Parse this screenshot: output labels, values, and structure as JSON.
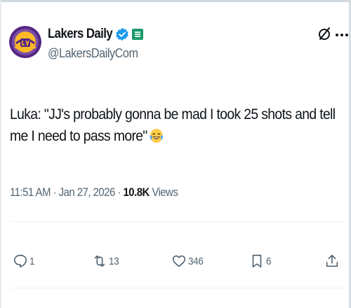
{
  "author": {
    "display_name": "Lakers Daily",
    "handle": "@LakersDailyCom",
    "verified": true,
    "affiliate_badge": true
  },
  "tweet": {
    "text": "Luka: \"JJ's probably gonna be mad I took 25 shots and tell me I need to pass more\"",
    "emoji": "face-with-tears-of-joy"
  },
  "meta": {
    "time": "11:51 AM",
    "separator": "·",
    "date": "Jan 27, 2026",
    "views_count": "10.8K",
    "views_label": "Views"
  },
  "actions": {
    "reply_count": "1",
    "retweet_count": "13",
    "like_count": "346",
    "bookmark_count": "6"
  },
  "colors": {
    "text": "#0f1419",
    "secondary": "#536471",
    "verified_blue": "#1d9bf0",
    "affiliate_green": "#1b9a6c",
    "lakers_purple": "#552583",
    "lakers_gold": "#fdb927"
  }
}
